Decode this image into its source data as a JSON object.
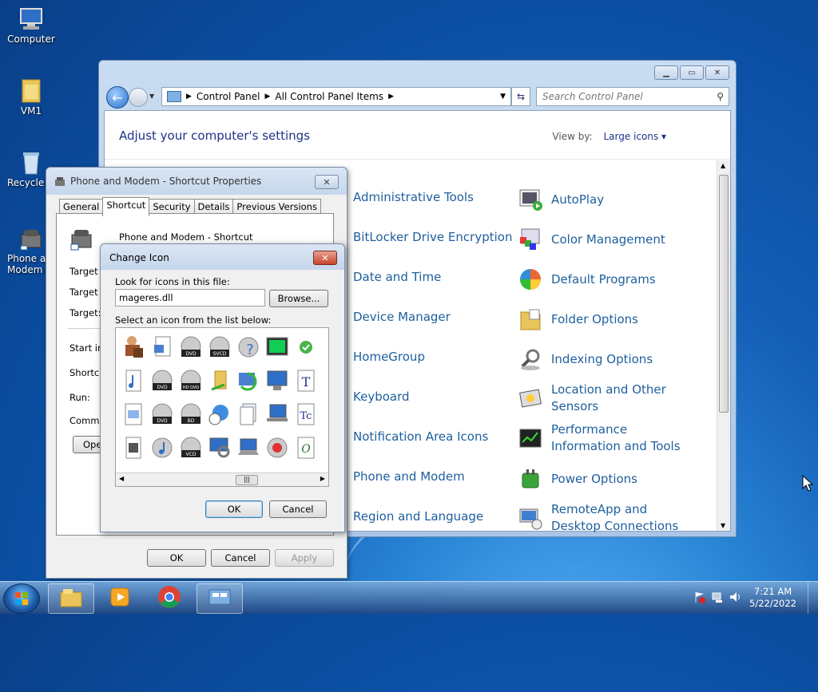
{
  "desktop": {
    "icons": [
      {
        "label": "Computer"
      },
      {
        "label": "VM1"
      },
      {
        "label": "Recycle B"
      },
      {
        "label": "Phone an\nModem"
      }
    ]
  },
  "control_panel": {
    "breadcrumbs": [
      "Control Panel",
      "All Control Panel Items"
    ],
    "search_placeholder": "Search Control Panel",
    "heading": "Adjust your computer's settings",
    "view_by_label": "View by:",
    "view_by_value": "Large icons",
    "items_left": [
      "Administrative Tools",
      "BitLocker Drive Encryption",
      "Date and Time",
      "Device Manager",
      "HomeGroup",
      "Keyboard",
      "Notification Area Icons",
      "Phone and Modem",
      "Region and Language"
    ],
    "items_right": [
      "AutoPlay",
      "Color Management",
      "Default Programs",
      "Folder Options",
      "Indexing Options",
      "Location and Other Sensors",
      "Performance Information and Tools",
      "Power Options",
      "RemoteApp and Desktop Connections"
    ]
  },
  "properties": {
    "title": "Phone and Modem - Shortcut Properties",
    "tabs": [
      "General",
      "Shortcut",
      "Security",
      "Details",
      "Previous Versions"
    ],
    "shortcut_name": "Phone and Modem - Shortcut",
    "labels": [
      "Target ty",
      "Target lo",
      "Target:",
      "Start in:",
      "Shortcut",
      "Run:",
      "Commen"
    ],
    "open_button": "Ope",
    "ok": "OK",
    "cancel": "Cancel",
    "apply": "Apply"
  },
  "change_icon": {
    "title": "Change Icon",
    "look_label": "Look for icons in this file:",
    "file_value": "mageres.dll",
    "browse": "Browse...",
    "select_label": "Select an icon from the list below:",
    "ok": "OK",
    "cancel": "Cancel"
  },
  "taskbar": {
    "time": "7:21 AM",
    "date": "5/22/2022"
  }
}
